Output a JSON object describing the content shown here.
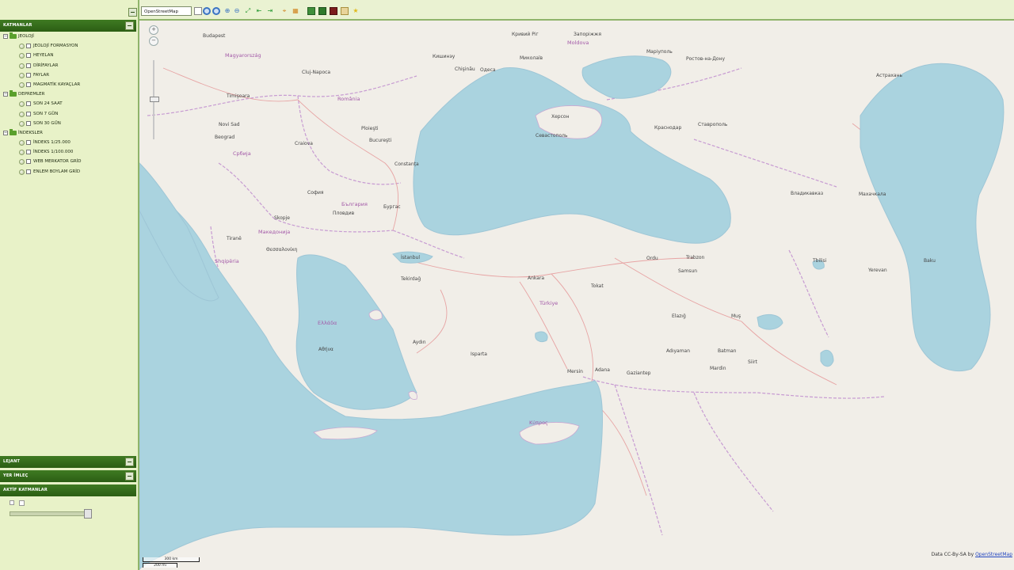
{
  "panels": {
    "layers_title": "KATMANLAR",
    "legend_title": "LEJANT",
    "search_title": "YER İMLEÇ",
    "active_layers_title": "AKTİF KATMANLAR"
  },
  "layers": [
    {
      "label": "JEOLOJİ",
      "children": [
        "JEOLOJİ FORMASYON",
        "HEYELAN",
        "DİRİFAYLAR",
        "FAYLAR",
        "MAGMATİK KAYAÇLAR"
      ]
    },
    {
      "label": "DEPREMLER",
      "children": [
        "SON 24 SAAT",
        "SON 7 GÜN",
        "SON 30 GÜN"
      ]
    },
    {
      "label": "İNDEKSLER",
      "children": [
        "İNDEKS 1/25.000",
        "İNDEKS 1/100.000",
        "WEB MERKATOR GRİD",
        "ENLEM BOYLAM GRİD"
      ]
    }
  ],
  "toolbar": {
    "base_layer": "OpenStreetMap",
    "colors": {
      "accent": "#2b5e14",
      "panel": "#e8f2c8"
    }
  },
  "map": {
    "zoom_in": "+",
    "zoom_out": "−",
    "attribution_text": "Data CC-By-SA by ",
    "attribution_link": "OpenStreetMap",
    "scale_top": "300 km",
    "scale_bottom": "200 mi",
    "colors": {
      "land": "#f1eee8",
      "water": "#aad3df",
      "border": "#b58cc2"
    },
    "labels": [
      {
        "text": "Budapest"
      },
      {
        "text": "Magyarország",
        "kind": "country"
      },
      {
        "text": "Cluj-Napoca"
      },
      {
        "text": "România",
        "kind": "country"
      },
      {
        "text": "Timişoara"
      },
      {
        "text": "Novi Sad"
      },
      {
        "text": "Beograd"
      },
      {
        "text": "Србија",
        "kind": "country"
      },
      {
        "text": "Bucureşti"
      },
      {
        "text": "Ploieşti"
      },
      {
        "text": "Craiova"
      },
      {
        "text": "Constanța"
      },
      {
        "text": "София"
      },
      {
        "text": "България",
        "kind": "country"
      },
      {
        "text": "Пловдив"
      },
      {
        "text": "Бургас"
      },
      {
        "text": "Skopje"
      },
      {
        "text": "Македонија",
        "kind": "country"
      },
      {
        "text": "Tiranë"
      },
      {
        "text": "Shqipëria",
        "kind": "country"
      },
      {
        "text": "Ελλάδα",
        "kind": "country"
      },
      {
        "text": "Αθήνα"
      },
      {
        "text": "Θεσσαλονίκη"
      },
      {
        "text": "İstanbul"
      },
      {
        "text": "Tekirdağ"
      },
      {
        "text": "Ankara"
      },
      {
        "text": "Türkiye",
        "kind": "country"
      },
      {
        "text": "Aydın"
      },
      {
        "text": "Isparta"
      },
      {
        "text": "Mersin"
      },
      {
        "text": "Adana"
      },
      {
        "text": "Gaziantep"
      },
      {
        "text": "Samsun"
      },
      {
        "text": "Tokat"
      },
      {
        "text": "Ordu"
      },
      {
        "text": "Trabzon"
      },
      {
        "text": "Elazığ"
      },
      {
        "text": "Batman"
      },
      {
        "text": "Mardin"
      },
      {
        "text": "Adıyaman"
      },
      {
        "text": "Muş"
      },
      {
        "text": "Siirt"
      },
      {
        "text": "Κύπρος",
        "kind": "country"
      },
      {
        "text": "Одеса"
      },
      {
        "text": "Миколаїв"
      },
      {
        "text": "Херсон"
      },
      {
        "text": "Кривий Ріг"
      },
      {
        "text": "Запоріжжя"
      },
      {
        "text": "Маріуполь"
      },
      {
        "text": "Ростов-на-Дону"
      },
      {
        "text": "Краснодар"
      },
      {
        "text": "Ставрополь"
      },
      {
        "text": "Астрахань"
      },
      {
        "text": "Севастополь"
      },
      {
        "text": "Владикавказ"
      },
      {
        "text": "Махачкала"
      },
      {
        "text": "Кишинэу"
      },
      {
        "text": "Moldova",
        "kind": "country"
      },
      {
        "text": "Chişinău"
      },
      {
        "text": "Tbilisi"
      },
      {
        "text": "Yerevan"
      },
      {
        "text": "Baku"
      }
    ]
  }
}
